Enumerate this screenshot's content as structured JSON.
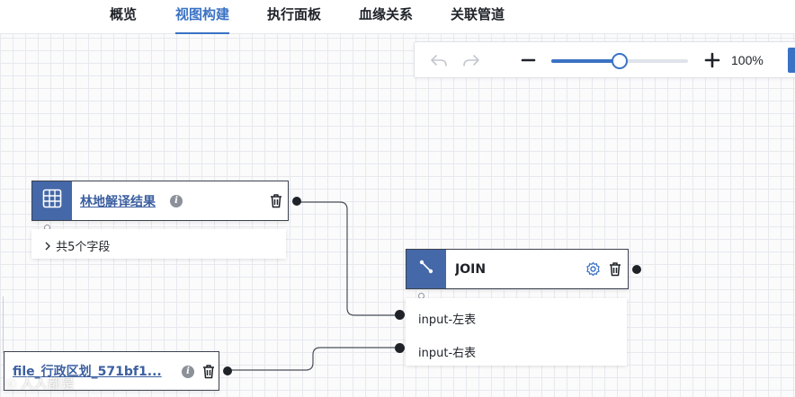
{
  "tabs": [
    {
      "label": "概览",
      "active": false
    },
    {
      "label": "视图构建",
      "active": true
    },
    {
      "label": "执行面板",
      "active": false
    },
    {
      "label": "血缘关系",
      "active": false
    },
    {
      "label": "关联管道",
      "active": false
    }
  ],
  "toolbar": {
    "zoom_level": "100%",
    "zoom_fraction": 0.5,
    "undo_icon": "undo-icon",
    "redo_icon": "redo-icon",
    "zoom_out_icon": "minus-icon",
    "zoom_in_icon": "plus-icon"
  },
  "nodes": {
    "source1": {
      "title": "林地解译结果",
      "icon": "table-grid-icon",
      "fields_summary": "共5个字段"
    },
    "join": {
      "title": "JOIN",
      "icon": "join-line-icon",
      "inputs": [
        "input-左表",
        "input-右表"
      ]
    },
    "source2": {
      "title": "file_行政区划_571bf1..."
    }
  },
  "watermark": "人人都是",
  "colors": {
    "accent": "#3a72c4",
    "node_icon_bg": "#4468a8",
    "link_text": "#3c5fa0"
  }
}
